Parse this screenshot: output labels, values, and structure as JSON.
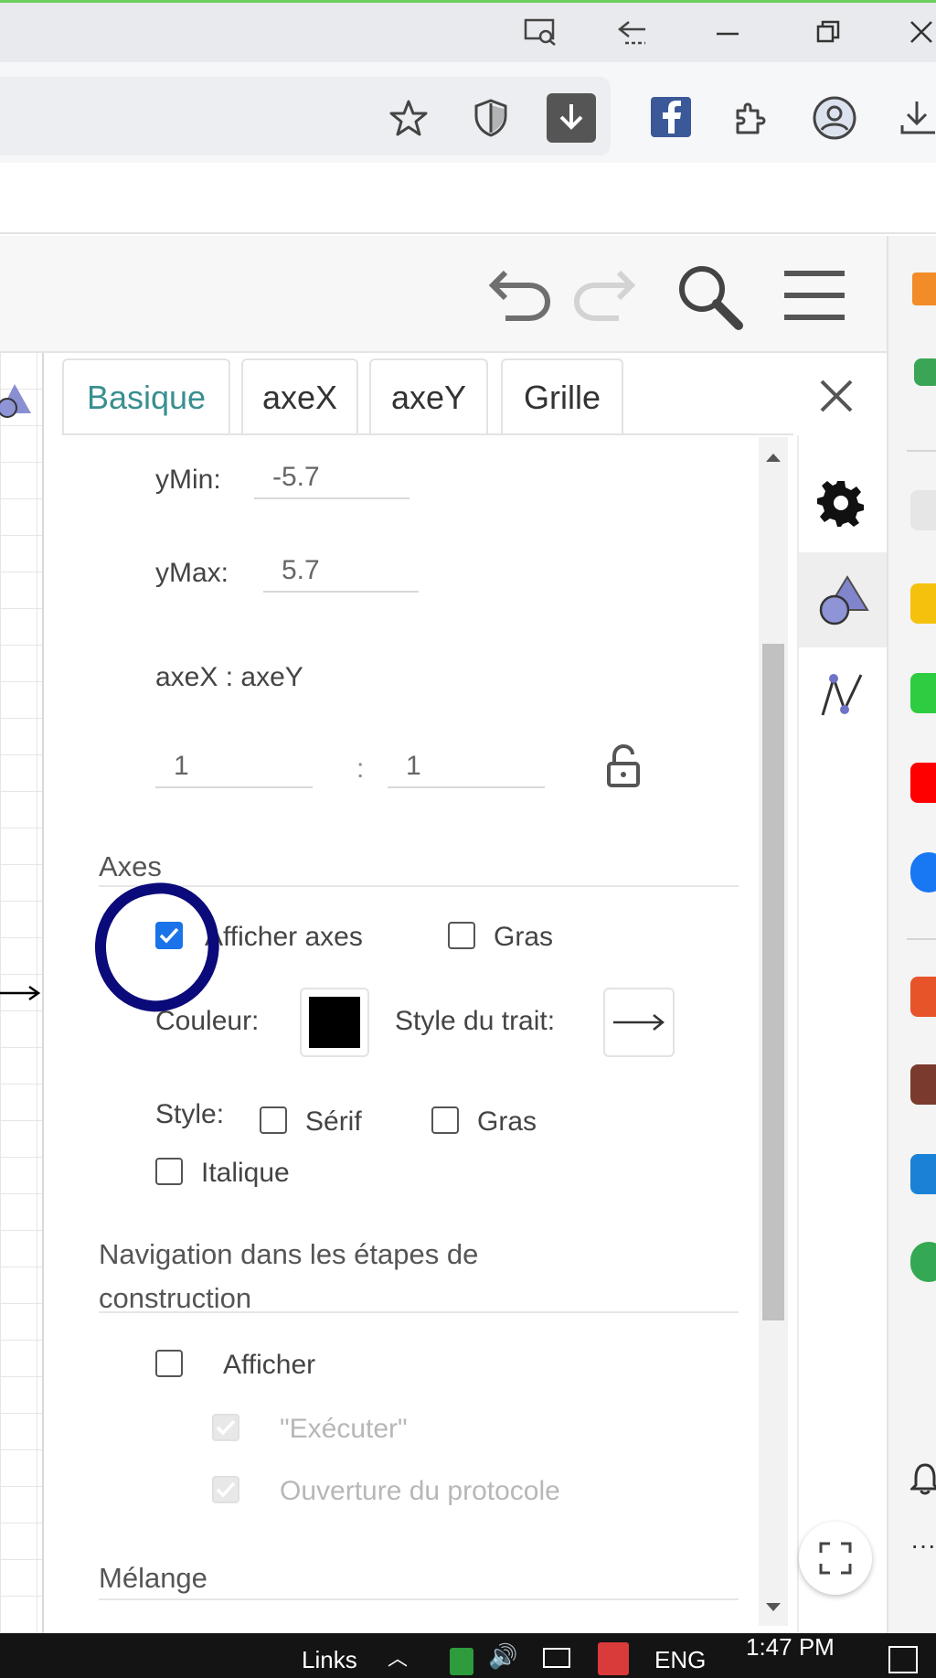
{
  "panel": {
    "tabs": [
      {
        "label": "Basique",
        "active": true
      },
      {
        "label": "axeX",
        "active": false
      },
      {
        "label": "axeY",
        "active": false
      },
      {
        "label": "Grille",
        "active": false
      }
    ],
    "ymin_label": "yMin:",
    "ymin_value": "-5.7",
    "ymax_label": "yMax:",
    "ymax_value": "5.7",
    "ratio_label": "axeX : axeY",
    "ratio_x": "1",
    "ratio_sep": ":",
    "ratio_y": "1",
    "axes_section": "Axes",
    "show_axes_label": "Afficher axes",
    "show_axes_checked": true,
    "bold_label": "Gras",
    "color_label": "Couleur:",
    "axis_color": "#000000",
    "line_style_label": "Style du trait:",
    "style_label": "Style:",
    "serif_label": "Sérif",
    "bold2_label": "Gras",
    "italic_label": "Italique",
    "nav_section": "Navigation dans les étapes de construction",
    "show_label": "Afficher",
    "execute_label": "\"Exécuter\"",
    "protocol_label": "Ouverture du protocole",
    "mix_section": "Mélange"
  },
  "taskbar": {
    "links_label": "Links",
    "lang": "ENG",
    "time": "1:47 PM"
  },
  "colors": {
    "accent": "#1a73e8",
    "active_tab": "#3a8f8f",
    "annotation": "#0a0a7a"
  }
}
